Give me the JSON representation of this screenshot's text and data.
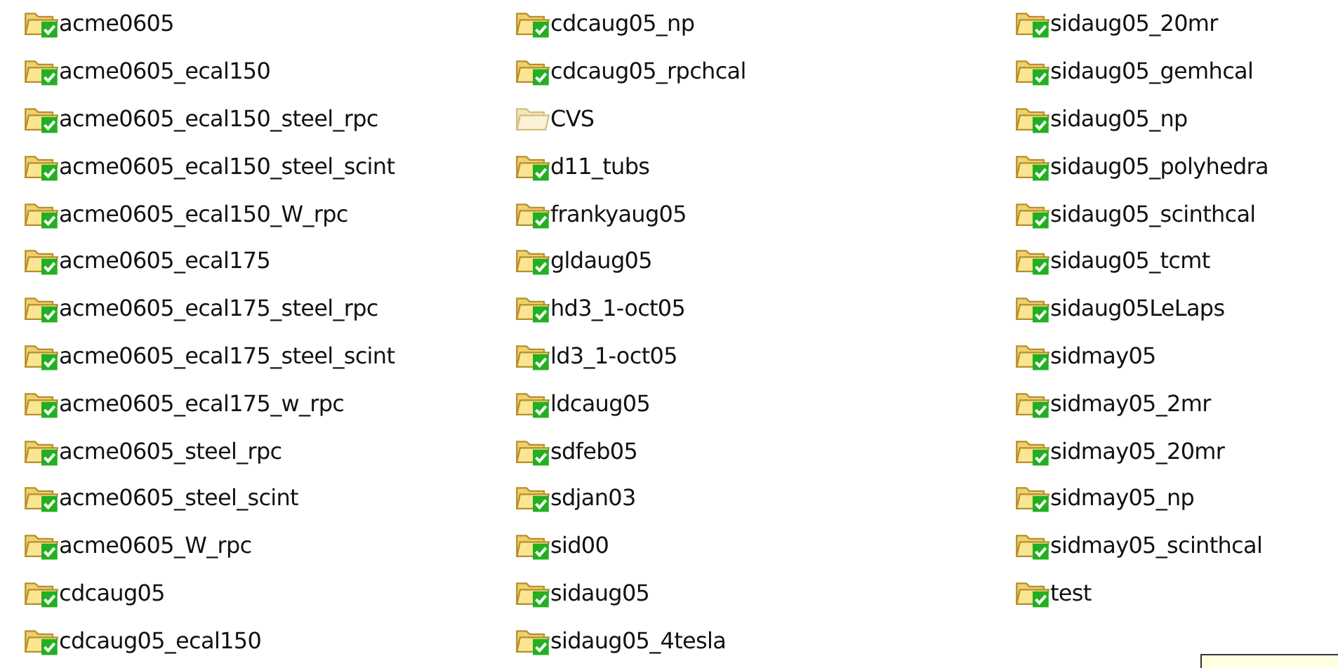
{
  "folders": [
    {
      "name": "acme0605",
      "versioned": true
    },
    {
      "name": "acme0605_ecal150",
      "versioned": true
    },
    {
      "name": "acme0605_ecal150_steel_rpc",
      "versioned": true
    },
    {
      "name": "acme0605_ecal150_steel_scint",
      "versioned": true
    },
    {
      "name": "acme0605_ecal150_W_rpc",
      "versioned": true
    },
    {
      "name": "acme0605_ecal175",
      "versioned": true
    },
    {
      "name": "acme0605_ecal175_steel_rpc",
      "versioned": true
    },
    {
      "name": "acme0605_ecal175_steel_scint",
      "versioned": true
    },
    {
      "name": "acme0605_ecal175_w_rpc",
      "versioned": true
    },
    {
      "name": "acme0605_steel_rpc",
      "versioned": true
    },
    {
      "name": "acme0605_steel_scint",
      "versioned": true
    },
    {
      "name": "acme0605_W_rpc",
      "versioned": true
    },
    {
      "name": "cdcaug05",
      "versioned": true
    },
    {
      "name": "cdcaug05_ecal150",
      "versioned": true
    },
    {
      "name": "cdcaug05_np",
      "versioned": true
    },
    {
      "name": "cdcaug05_rpchcal",
      "versioned": true
    },
    {
      "name": "CVS",
      "versioned": false
    },
    {
      "name": "d11_tubs",
      "versioned": true
    },
    {
      "name": "frankyaug05",
      "versioned": true
    },
    {
      "name": "gldaug05",
      "versioned": true
    },
    {
      "name": "hd3_1-oct05",
      "versioned": true
    },
    {
      "name": "ld3_1-oct05",
      "versioned": true
    },
    {
      "name": "ldcaug05",
      "versioned": true
    },
    {
      "name": "sdfeb05",
      "versioned": true
    },
    {
      "name": "sdjan03",
      "versioned": true
    },
    {
      "name": "sid00",
      "versioned": true
    },
    {
      "name": "sidaug05",
      "versioned": true
    },
    {
      "name": "sidaug05_4tesla",
      "versioned": true
    },
    {
      "name": "sidaug05_20mr",
      "versioned": true
    },
    {
      "name": "sidaug05_gemhcal",
      "versioned": true
    },
    {
      "name": "sidaug05_np",
      "versioned": true
    },
    {
      "name": "sidaug05_polyhedra",
      "versioned": true
    },
    {
      "name": "sidaug05_scinthcal",
      "versioned": true
    },
    {
      "name": "sidaug05_tcmt",
      "versioned": true
    },
    {
      "name": "sidaug05LeLaps",
      "versioned": true
    },
    {
      "name": "sidmay05",
      "versioned": true
    },
    {
      "name": "sidmay05_2mr",
      "versioned": true
    },
    {
      "name": "sidmay05_20mr",
      "versioned": true
    },
    {
      "name": "sidmay05_np",
      "versioned": true
    },
    {
      "name": "sidmay05_scinthcal",
      "versioned": true
    },
    {
      "name": "test",
      "versioned": true
    }
  ]
}
